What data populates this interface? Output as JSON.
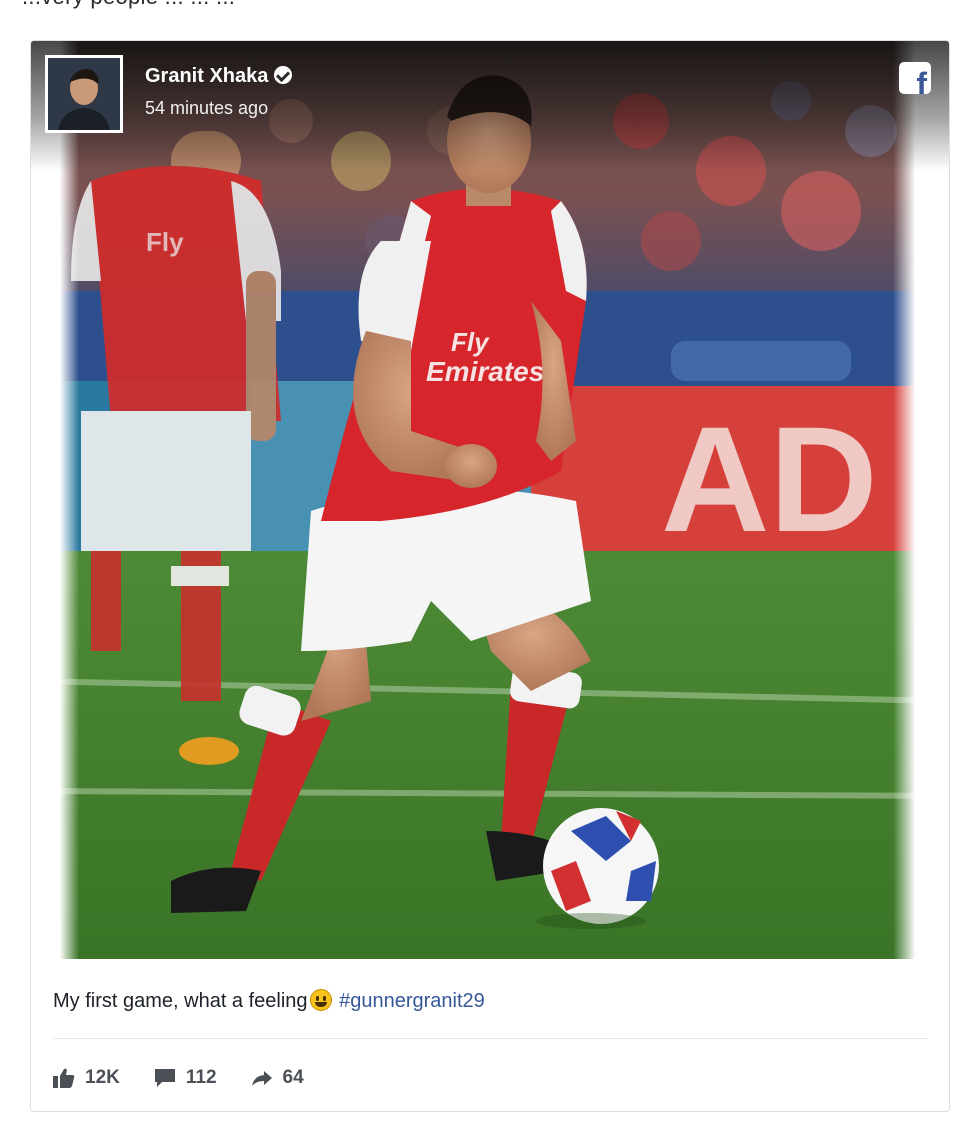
{
  "header_crop_text": "...very people ... ... ...",
  "post": {
    "author": "Granit Xhaka",
    "timestamp": "54 minutes ago",
    "caption_text": "My first game, what a feeling",
    "hashtag": "#gunnergranit29",
    "platform_icon": "facebook-icon"
  },
  "photo": {
    "shirt_text_1": "Fly",
    "shirt_text_2": "Emirates",
    "banner_text": "AD"
  },
  "stats": {
    "likes": "12K",
    "comments": "112",
    "shares": "64"
  },
  "colors": {
    "author_text": "#ffffff",
    "hashtag": "#365899",
    "stat_text": "#4b4f56",
    "facebook": "#3b5998",
    "kit_red": "#d5202a",
    "pitch_green": "#3f7d2c"
  },
  "icons": {
    "like": "thumbs-up-icon",
    "comment": "comment-bubble-icon",
    "share": "share-arrow-icon",
    "verified": "verified-badge-icon"
  }
}
